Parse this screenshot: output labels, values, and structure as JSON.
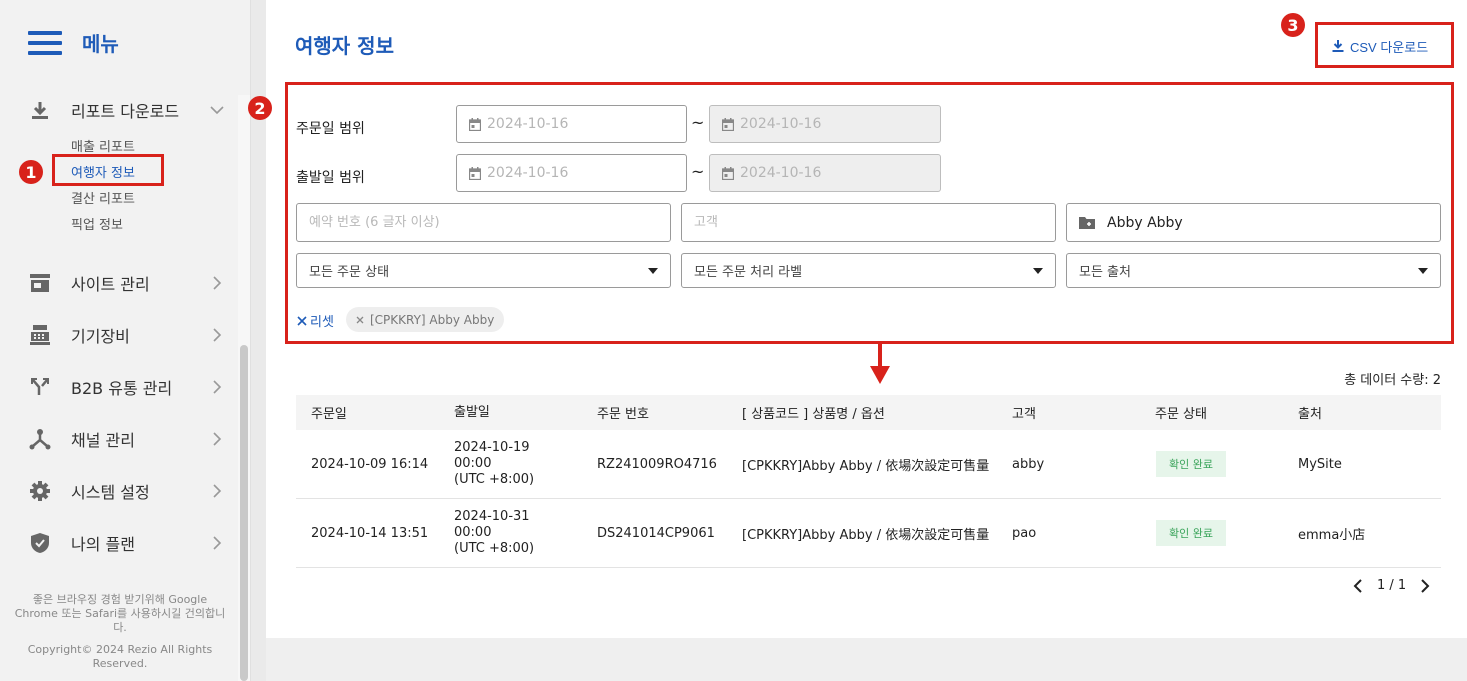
{
  "sidebar": {
    "menu_title": "메뉴",
    "report_download": "리포트 다운로드",
    "sub_items": [
      "매출 리포트",
      "여행자 정보",
      "결산 리포트",
      "픽업 정보"
    ],
    "site_manage": "사이트 관리",
    "equipment": "기기장비",
    "b2b": "B2B 유통 관리",
    "channel": "채널 관리",
    "system": "시스템 설정",
    "plan": "나의 플랜",
    "browser_note": "좋은 브라우징 경험 받기위해 Google Chrome 또는 Safari를 사용하시길 건의합니다.",
    "copyright": "Copyright© 2024 Rezio All Rights Reserved."
  },
  "header": {
    "title": "여행자 정보",
    "csv_label": "CSV 다운로드"
  },
  "annotations": {
    "one": "1",
    "two": "2",
    "three": "3",
    "accent": "#d8221b"
  },
  "filters": {
    "order_range_label": "주문일 범위",
    "departure_range_label": "출발일 범위",
    "date_from": "2024-10-16",
    "date_to": "2024-10-16",
    "tilde": "~",
    "booking_placeholder": "예약 번호 (6 글자 이상)",
    "customer_placeholder": "고객",
    "product_value": "Abby Abby",
    "order_status": "모든 주문 상태",
    "processing_label": "모든 주문 처리 라벨",
    "source": "모든 출처",
    "reset": "리셋",
    "chip": "[CPKKRY] Abby Abby"
  },
  "table": {
    "total": "총 데이터 수량: 2",
    "headers": [
      "주문일",
      "출발일",
      "주문 번호",
      "[ 상품코드 ] 상품명 / 옵션",
      "고객",
      "주문 상태",
      "출처"
    ],
    "rows": [
      {
        "order_date": "2024-10-09 16:14",
        "dep_date": "2024-10-19",
        "dep_time": "00:00",
        "dep_tz": "(UTC +8:00)",
        "order_no": "RZ241009RO4716",
        "product": "[CPKKRY]Abby Abby / 依場次設定可售量",
        "customer": "abby",
        "status": "확인 완료",
        "source": "MySite"
      },
      {
        "order_date": "2024-10-14 13:51",
        "dep_date": "2024-10-31",
        "dep_time": "00:00",
        "dep_tz": "(UTC +8:00)",
        "order_no": "DS241014CP9061",
        "product": "[CPKKRY]Abby Abby / 依場次設定可售量",
        "customer": "pao",
        "status": "확인 완료",
        "source": "emma小店"
      }
    ]
  },
  "pagination": {
    "text": "1 / 1"
  },
  "colors": {
    "brand": "#1e5bb8",
    "status_bg": "#e6f5ea",
    "status_fg": "#3aa45a"
  }
}
